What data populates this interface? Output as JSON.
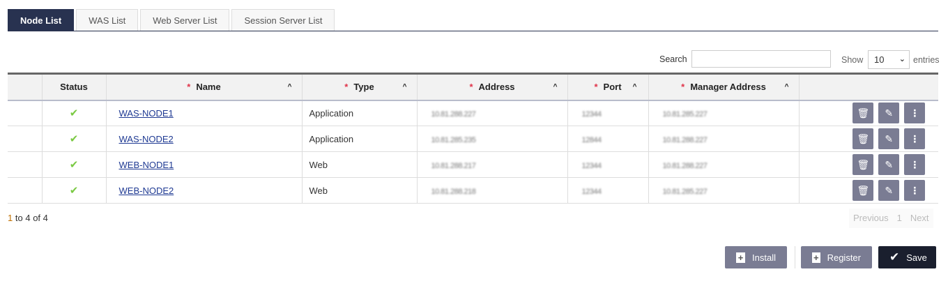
{
  "tabs": [
    {
      "label": "Node List",
      "active": true
    },
    {
      "label": "WAS List"
    },
    {
      "label": "Web Server List"
    },
    {
      "label": "Session Server List"
    }
  ],
  "search": {
    "label": "Search",
    "value": ""
  },
  "show": {
    "label": "Show",
    "value": "10",
    "suffix": "entries"
  },
  "columns": [
    "Status",
    "Name",
    "Type",
    "Address",
    "Port",
    "Manager Address"
  ],
  "rows": [
    {
      "name": "WAS-NODE1",
      "type": "Application",
      "address": "10.81.288.227",
      "port": "12344",
      "manager": "10.81.285.227"
    },
    {
      "name": "WAS-NODE2",
      "type": "Application",
      "address": "10.81.285.235",
      "port": "12844",
      "manager": "10.81.288.227"
    },
    {
      "name": "WEB-NODE1",
      "type": "Web",
      "address": "10.81.288.217",
      "port": "12344",
      "manager": "10.81.288.227"
    },
    {
      "name": "WEB-NODE2",
      "type": "Web",
      "address": "10.81.288.218",
      "port": "12344",
      "manager": "10.81.285.227"
    }
  ],
  "info": {
    "from": "1",
    "to_label": "to",
    "to": "4",
    "of_label": "of",
    "total": "4"
  },
  "pager": {
    "previous": "Previous",
    "page": "1",
    "next": "Next"
  },
  "buttons": {
    "install": "Install",
    "register": "Register",
    "save": "Save"
  },
  "colors": {
    "accent": "#283250",
    "action": "#7a7c93",
    "save": "#1a1f2e",
    "status_ok": "#7ac943"
  }
}
